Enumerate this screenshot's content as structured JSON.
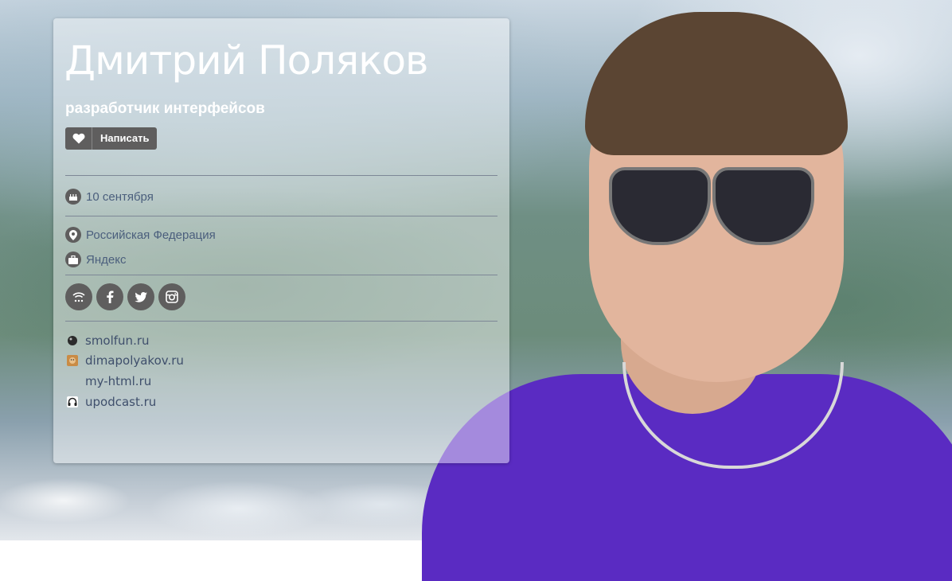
{
  "profile": {
    "name": "Дмитрий Поляков",
    "position": "разработчик интерфейсов"
  },
  "actions": {
    "like_icon": "heart-icon",
    "write_label": "Написать"
  },
  "info": {
    "birthday": "10 сентября",
    "country": "Российская Федерация",
    "company": "Яндекс"
  },
  "socials": [
    {
      "name": "rss",
      "icon": "rss-icon"
    },
    {
      "name": "facebook",
      "icon": "facebook-icon"
    },
    {
      "name": "twitter",
      "icon": "twitter-icon"
    },
    {
      "name": "instagram",
      "icon": "instagram-icon"
    }
  ],
  "links": [
    {
      "label": "smolfun.ru",
      "icon": "smolfun-favicon"
    },
    {
      "label": "dimapolyakov.ru",
      "icon": "dimapolyakov-favicon"
    },
    {
      "label": "my-html.ru",
      "icon": ""
    },
    {
      "label": "upodcast.ru",
      "icon": "upodcast-favicon"
    }
  ],
  "colors": {
    "button_bg": "#5f5e5e",
    "info_text": "#4b5f7d",
    "link_text": "#3f4f6c",
    "shirt": "#5a2bc2"
  }
}
